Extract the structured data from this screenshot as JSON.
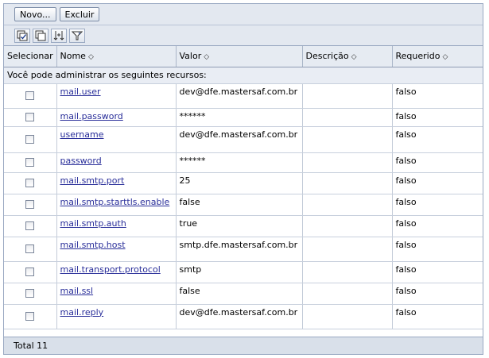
{
  "toolbar": {
    "new_label": "Novo...",
    "delete_label": "Excluir"
  },
  "icons": [
    "select-all-icon",
    "deselect-all-icon",
    "expand-filter-icon",
    "filter-icon"
  ],
  "table": {
    "columns": [
      {
        "label": "Selecionar",
        "sortable": false
      },
      {
        "label": "Nome",
        "sortable": true
      },
      {
        "label": "Valor",
        "sortable": true
      },
      {
        "label": "Descrição",
        "sortable": true
      },
      {
        "label": "Requerido",
        "sortable": true
      }
    ],
    "sort_glyph": "◇",
    "note": "Você pode administrar os seguintes recursos:",
    "rows": [
      {
        "name": "mail.user",
        "value": "dev@dfe.mastersaf.com.br",
        "description": "",
        "required": "falso"
      },
      {
        "name": "mail.password",
        "value": "******",
        "description": "",
        "required": "falso"
      },
      {
        "name": "username",
        "value": "dev@dfe.mastersaf.com.br",
        "description": "",
        "required": "falso"
      },
      {
        "name": "password",
        "value": "******",
        "description": "",
        "required": "falso"
      },
      {
        "name": "mail.smtp.port",
        "value": "25",
        "description": "",
        "required": "falso"
      },
      {
        "name": "mail.smtp.starttls.enable",
        "value": "false",
        "description": "",
        "required": "falso"
      },
      {
        "name": "mail.smtp.auth",
        "value": "true",
        "description": "",
        "required": "falso"
      },
      {
        "name": "mail.smtp.host",
        "value": "smtp.dfe.mastersaf.com.br",
        "description": "",
        "required": "falso"
      },
      {
        "name": "mail.transport.protocol",
        "value": "smtp",
        "description": "",
        "required": "falso"
      },
      {
        "name": "mail.ssl",
        "value": "false",
        "description": "",
        "required": "falso"
      },
      {
        "name": "mail.reply",
        "value": "dev@dfe.mastersaf.com.br",
        "description": "",
        "required": "falso"
      }
    ]
  },
  "footer": {
    "total_label": "Total 11"
  }
}
